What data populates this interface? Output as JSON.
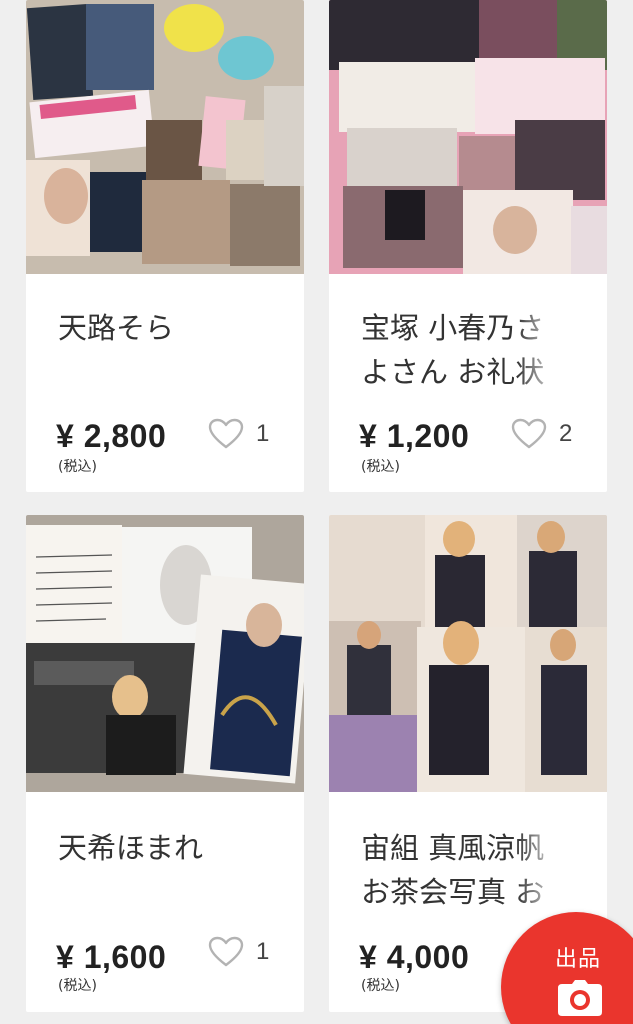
{
  "items": [
    {
      "title": "天路そら",
      "price": "¥ 2,800",
      "tax_label": "(税込)",
      "likes": "1",
      "thumb_palette": {
        "bg": "#c9bfb3",
        "accent1": "#f0e24a",
        "accent2": "#6ec6d2",
        "accent3": "#e05a8a"
      }
    },
    {
      "title": "宝塚 小春乃さよさん お礼状",
      "price": "¥ 1,200",
      "tax_label": "(税込)",
      "likes": "2",
      "thumb_palette": {
        "bg": "#e9a7b9",
        "accent1": "#3b3640",
        "accent2": "#f1e7e3",
        "accent3": "#7d5b63"
      }
    },
    {
      "title": "天希ほまれ",
      "price": "¥ 1,600",
      "tax_label": "(税込)",
      "likes": "1",
      "thumb_palette": {
        "bg": "#a9a29a",
        "accent1": "#f6f3ee",
        "accent2": "#3a3a3a",
        "accent3": "#1d2f55"
      }
    },
    {
      "title": "宙組 真風涼帆お茶会写真 おまとめ",
      "price": "¥ 4,000",
      "tax_label": "(税込)",
      "likes": "",
      "thumb_palette": {
        "bg": "#e7dcd2",
        "accent1": "#2d2a34",
        "accent2": "#d8bfa2",
        "accent3": "#8a6e9b"
      }
    }
  ],
  "sell_button": {
    "label": "出品",
    "icon": "camera-icon",
    "color": "#ea352d"
  },
  "icons": {
    "like": "heart-outline-icon"
  }
}
